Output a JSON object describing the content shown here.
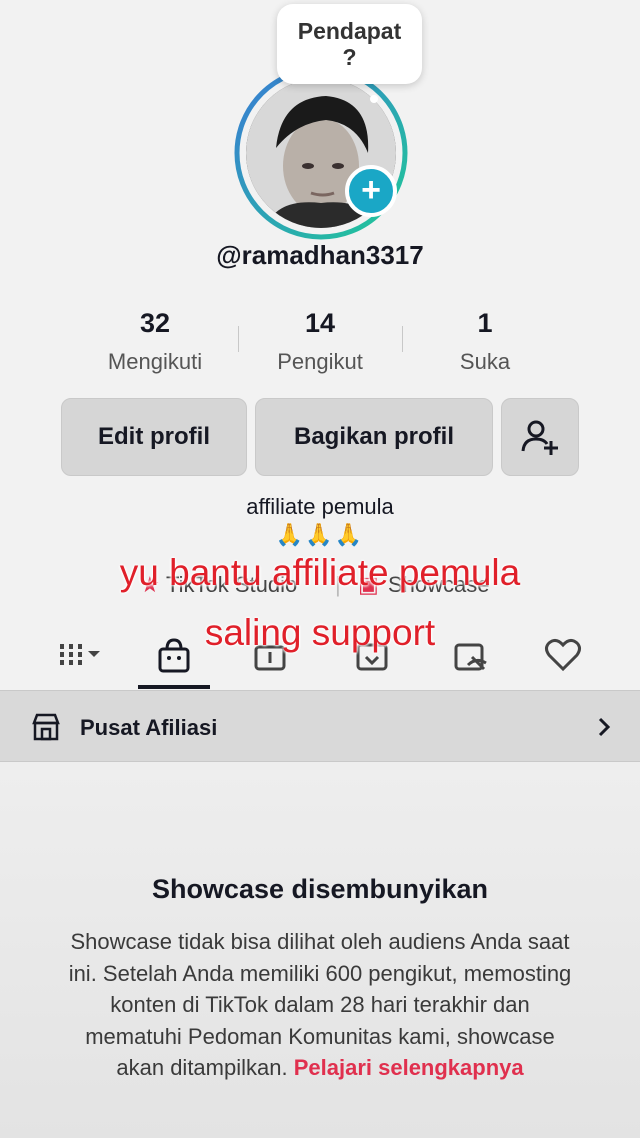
{
  "profile": {
    "tooltip": "Pendapat\n?",
    "tooltip_line1": "Pendapat",
    "tooltip_line2": "?",
    "username": "@ramadhan3317",
    "bio": "affiliate pemula",
    "bio_emoji": "🙏🙏🙏"
  },
  "stats": [
    {
      "value": "32",
      "label": "Mengikuti"
    },
    {
      "value": "14",
      "label": "Pengikut"
    },
    {
      "value": "1",
      "label": "Suka"
    }
  ],
  "buttons": {
    "edit": "Edit profil",
    "share": "Bagikan profil"
  },
  "links": {
    "studio": "TikTok Studio",
    "showcase": "Showcase"
  },
  "overlay": {
    "line1": "yu bantu affiliate pemula",
    "line2": "saling support"
  },
  "tabs": [
    "videos-grid-icon",
    "shop-bag-icon",
    "repost-icon",
    "saved-icon",
    "private-icon",
    "liked-heart-icon"
  ],
  "affiliate": {
    "label": "Pusat Afiliasi"
  },
  "showcase": {
    "title": "Showcase disembunyikan",
    "body": "Showcase tidak bisa dilihat oleh audiens Anda saat ini. Setelah Anda memiliki 600 pengikut, memosting konten di TikTok dalam 28 hari terakhir dan mematuhi Pedoman Komunitas kami, showcase akan ditampilkan.",
    "link": "Pelajari selengkapnya"
  },
  "colors": {
    "accent_cyan": "#1aa7c6",
    "overlay_red": "#e0202a",
    "link_red": "#e0304e"
  }
}
